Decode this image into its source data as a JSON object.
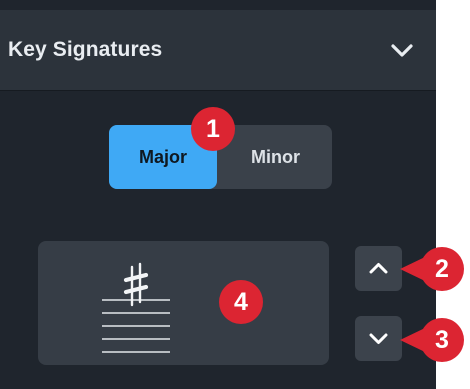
{
  "panel": {
    "title": "Key Signatures",
    "collapse_icon": "chevron-down-icon"
  },
  "mode_toggle": {
    "options": [
      "Major",
      "Minor"
    ],
    "selected": "Major"
  },
  "key_preview": {
    "symbol": "♯",
    "staff_lines": 5
  },
  "stepper": {
    "up_icon": "chevron-up-icon",
    "down_icon": "chevron-down-icon"
  },
  "callouts": [
    "1",
    "2",
    "3",
    "4"
  ],
  "colors": {
    "panel_bg": "#1f252d",
    "header_bg": "#2c333b",
    "accent": "#3fa9f5",
    "callout": "#dc2532"
  }
}
